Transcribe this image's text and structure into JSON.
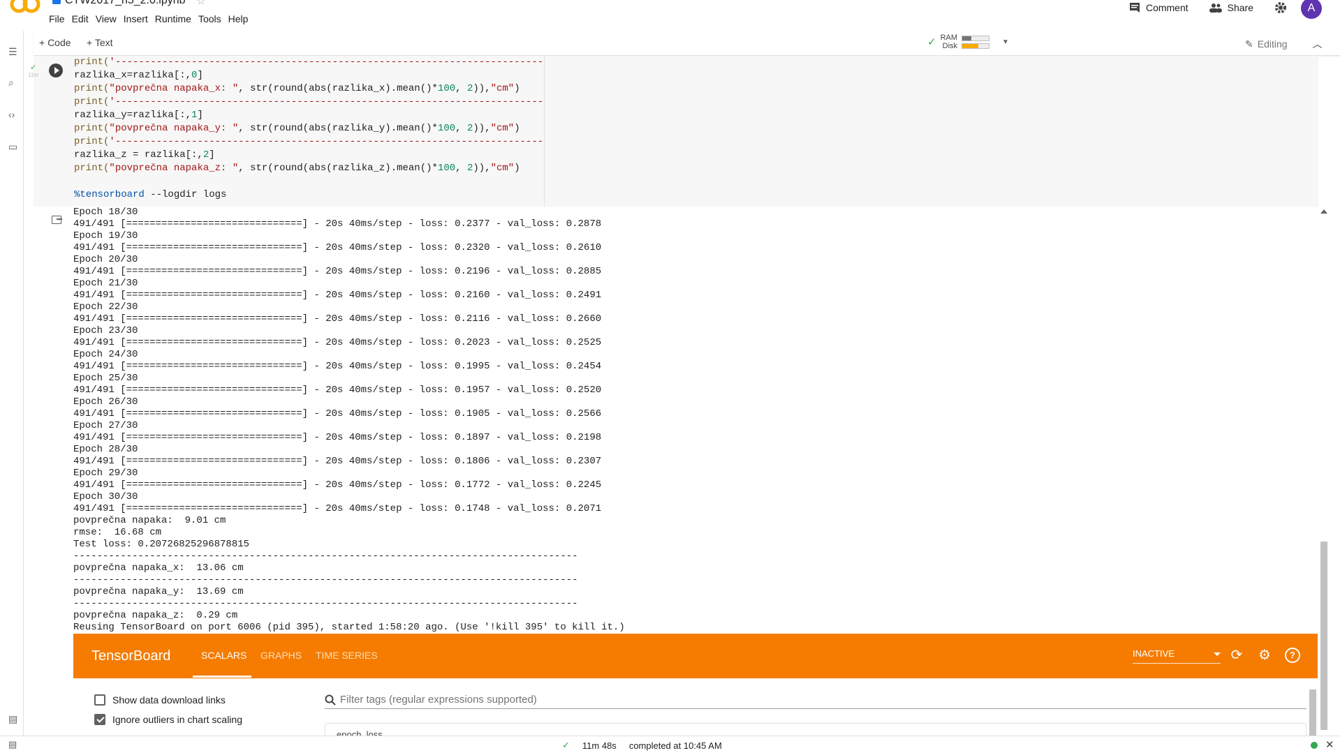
{
  "notebook": {
    "title": "CTW2017_h5_2.0.ipynb"
  },
  "menu": [
    "File",
    "Edit",
    "View",
    "Insert",
    "Runtime",
    "Tools",
    "Help"
  ],
  "header": {
    "comment": "Comment",
    "share": "Share",
    "avatar": "A"
  },
  "toolbar": {
    "code": "+ Code",
    "text": "+ Text",
    "ram": "RAM",
    "disk": "Disk",
    "editing": "Editing",
    "ram_level": 0.35,
    "disk_level": 0.6
  },
  "cell": {
    "exec_time": "11m",
    "lines": [
      [
        {
          "t": "print(",
          "c": "fn"
        },
        {
          "t": "'--------------------------------------------------------------------------------------')",
          "c": "str"
        }
      ],
      [
        {
          "t": "razlika_x=razlika[:,",
          "c": ""
        },
        {
          "t": "0",
          "c": "num"
        },
        {
          "t": "]",
          "c": ""
        }
      ],
      [
        {
          "t": "print(",
          "c": "fn"
        },
        {
          "t": "\"povprečna napaka_x: \"",
          "c": "str"
        },
        {
          "t": ", str(round(abs(razlika_x).mean()*",
          "c": ""
        },
        {
          "t": "100",
          "c": "num"
        },
        {
          "t": ", ",
          "c": ""
        },
        {
          "t": "2",
          "c": "num"
        },
        {
          "t": ")),",
          "c": ""
        },
        {
          "t": "\"cm\"",
          "c": "str"
        },
        {
          "t": ")",
          "c": ""
        }
      ],
      [
        {
          "t": "print(",
          "c": "fn"
        },
        {
          "t": "'--------------------------------------------------------------------------------------')",
          "c": "str"
        }
      ],
      [
        {
          "t": "razlika_y=razlika[:,",
          "c": ""
        },
        {
          "t": "1",
          "c": "num"
        },
        {
          "t": "]",
          "c": ""
        }
      ],
      [
        {
          "t": "print(",
          "c": "fn"
        },
        {
          "t": "\"povprečna napaka_y: \"",
          "c": "str"
        },
        {
          "t": ", str(round(abs(razlika_y).mean()*",
          "c": ""
        },
        {
          "t": "100",
          "c": "num"
        },
        {
          "t": ", ",
          "c": ""
        },
        {
          "t": "2",
          "c": "num"
        },
        {
          "t": ")),",
          "c": ""
        },
        {
          "t": "\"cm\"",
          "c": "str"
        },
        {
          "t": ")",
          "c": ""
        }
      ],
      [
        {
          "t": "print(",
          "c": "fn"
        },
        {
          "t": "'--------------------------------------------------------------------------------------')",
          "c": "str"
        }
      ],
      [
        {
          "t": "razlika_z = razlika[:,",
          "c": ""
        },
        {
          "t": "2",
          "c": "num"
        },
        {
          "t": "]",
          "c": ""
        }
      ],
      [
        {
          "t": "print(",
          "c": "fn"
        },
        {
          "t": "\"povprečna napaka_z: \"",
          "c": "str"
        },
        {
          "t": ", str(round(abs(razlika_z).mean()*",
          "c": ""
        },
        {
          "t": "100",
          "c": "num"
        },
        {
          "t": ", ",
          "c": ""
        },
        {
          "t": "2",
          "c": "num"
        },
        {
          "t": ")),",
          "c": ""
        },
        {
          "t": "\"cm\"",
          "c": "str"
        },
        {
          "t": ")",
          "c": ""
        }
      ],
      [],
      [
        {
          "t": "%tensorboard",
          "c": "magic"
        },
        {
          "t": " --logdir logs",
          "c": ""
        }
      ]
    ]
  },
  "output_lines": [
    "Epoch 18/30",
    "491/491 [==============================] - 20s 40ms/step - loss: 0.2377 - val_loss: 0.2878",
    "Epoch 19/30",
    "491/491 [==============================] - 20s 40ms/step - loss: 0.2320 - val_loss: 0.2610",
    "Epoch 20/30",
    "491/491 [==============================] - 20s 40ms/step - loss: 0.2196 - val_loss: 0.2885",
    "Epoch 21/30",
    "491/491 [==============================] - 20s 40ms/step - loss: 0.2160 - val_loss: 0.2491",
    "Epoch 22/30",
    "491/491 [==============================] - 20s 40ms/step - loss: 0.2116 - val_loss: 0.2660",
    "Epoch 23/30",
    "491/491 [==============================] - 20s 40ms/step - loss: 0.2023 - val_loss: 0.2525",
    "Epoch 24/30",
    "491/491 [==============================] - 20s 40ms/step - loss: 0.1995 - val_loss: 0.2454",
    "Epoch 25/30",
    "491/491 [==============================] - 20s 40ms/step - loss: 0.1957 - val_loss: 0.2520",
    "Epoch 26/30",
    "491/491 [==============================] - 20s 40ms/step - loss: 0.1905 - val_loss: 0.2566",
    "Epoch 27/30",
    "491/491 [==============================] - 20s 40ms/step - loss: 0.1897 - val_loss: 0.2198",
    "Epoch 28/30",
    "491/491 [==============================] - 20s 40ms/step - loss: 0.1806 - val_loss: 0.2307",
    "Epoch 29/30",
    "491/491 [==============================] - 20s 40ms/step - loss: 0.1772 - val_loss: 0.2245",
    "Epoch 30/30",
    "491/491 [==============================] - 20s 40ms/step - loss: 0.1748 - val_loss: 0.2071",
    "povprečna napaka:  9.01 cm",
    "rmse:  16.68 cm",
    "Test loss: 0.20726825296878815",
    "--------------------------------------------------------------------------------------",
    "povprečna napaka_x:  13.06 cm",
    "--------------------------------------------------------------------------------------",
    "povprečna napaka_y:  13.69 cm",
    "--------------------------------------------------------------------------------------",
    "povprečna napaka_z:  0.29 cm",
    "Reusing TensorBoard on port 6006 (pid 395), started 1:58:20 ago. (Use '!kill 395' to kill it.)"
  ],
  "tensorboard": {
    "brand": "TensorBoard",
    "tabs": [
      "SCALARS",
      "GRAPHS",
      "TIME SERIES"
    ],
    "status": "INACTIVE",
    "show_download": "Show data download links",
    "ignore_outliers": "Ignore outliers in chart scaling",
    "filter_placeholder": "Filter tags (regular expressions supported)",
    "card_title": "epoch_loss"
  },
  "statusbar": {
    "duration": "11m 48s",
    "completed": "completed at 10:45 AM"
  },
  "colors": {
    "accent": "#f57c00",
    "avatar": "#5e35b1",
    "ok": "#34a853"
  }
}
